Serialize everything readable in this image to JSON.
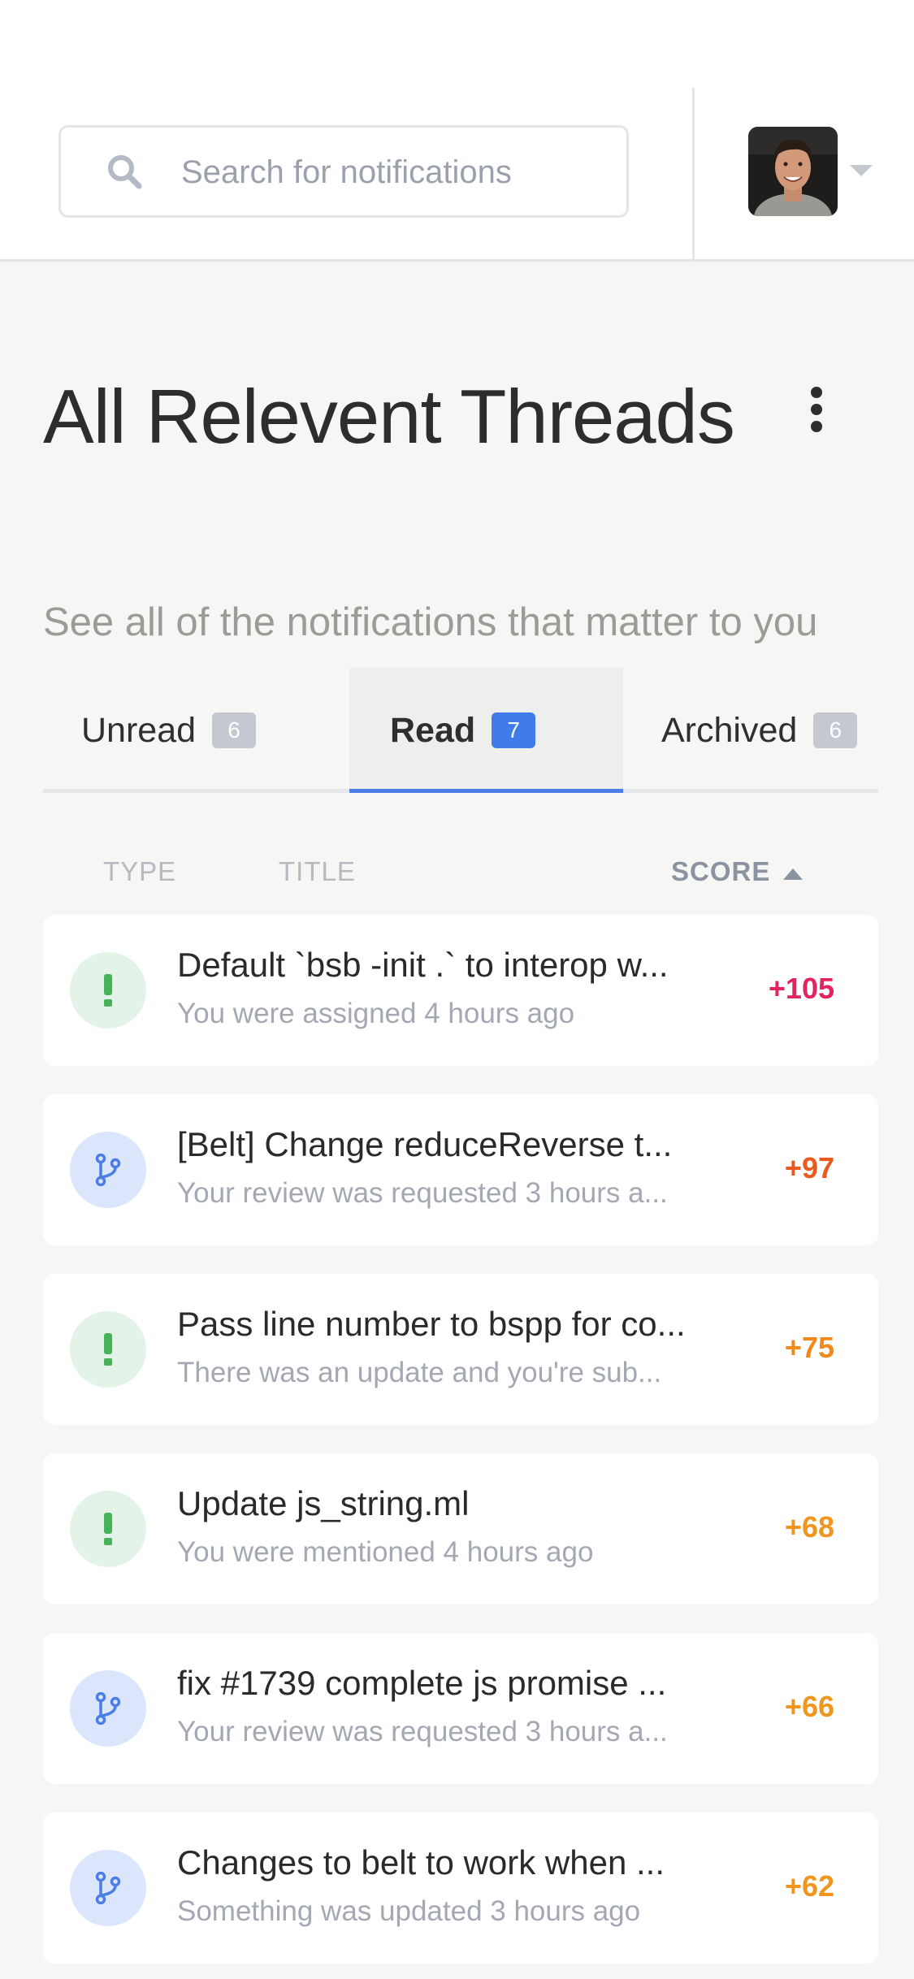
{
  "header": {
    "search_placeholder": "Search for notifications",
    "icons": {
      "search": "search-icon",
      "avatar": "user-avatar",
      "caret": "chevron-down-icon"
    }
  },
  "page": {
    "title": "All Relevent Threads",
    "subtitle": "See all of the notifications that matter to you",
    "more_icon": "more-vertical-icon"
  },
  "tabs": [
    {
      "label": "Unread",
      "count": "6",
      "active": false
    },
    {
      "label": "Read",
      "count": "7",
      "active": true
    },
    {
      "label": "Archived",
      "count": "6",
      "active": false
    }
  ],
  "columns": {
    "type": "TYPE",
    "title": "TITLE",
    "score": "SCORE",
    "sort_icon": "sort-ascending-icon"
  },
  "colors": {
    "accent": "#3f7be9",
    "issue_icon": "#46b35a",
    "pr_icon": "#4a7ee6",
    "score_105": "#e4235f",
    "score_97": "#ea5a1e",
    "score_75": "#f08a1d",
    "score_68": "#f0961f",
    "score_66": "#f0961f",
    "score_62": "#f0961f"
  },
  "notifications": [
    {
      "type": "issue",
      "icon": "exclamation-icon",
      "title": "Default `bsb -init .` to interop w...",
      "subtitle": "You were assigned 4 hours ago",
      "score": "+105",
      "score_color": "#e4235f"
    },
    {
      "type": "pr",
      "icon": "git-branch-icon",
      "title": "[Belt] Change reduceReverse t...",
      "subtitle": "Your review was requested 3 hours a...",
      "score": "+97",
      "score_color": "#ea5a1e"
    },
    {
      "type": "issue",
      "icon": "exclamation-icon",
      "title": "Pass line number to bspp for co...",
      "subtitle": "There was an update and you're sub...",
      "score": "+75",
      "score_color": "#f08a1d"
    },
    {
      "type": "issue",
      "icon": "exclamation-icon",
      "title": "Update js_string.ml",
      "subtitle": "You were mentioned 4 hours ago",
      "score": "+68",
      "score_color": "#f0961f"
    },
    {
      "type": "pr",
      "icon": "git-branch-icon",
      "title": "fix #1739 complete js promise ...",
      "subtitle": "Your review was requested 3 hours a...",
      "score": "+66",
      "score_color": "#f0961f"
    },
    {
      "type": "pr",
      "icon": "git-branch-icon",
      "title": "Changes to belt to work when ...",
      "subtitle": "Something was updated 3 hours ago",
      "score": "+62",
      "score_color": "#f0961f"
    }
  ]
}
